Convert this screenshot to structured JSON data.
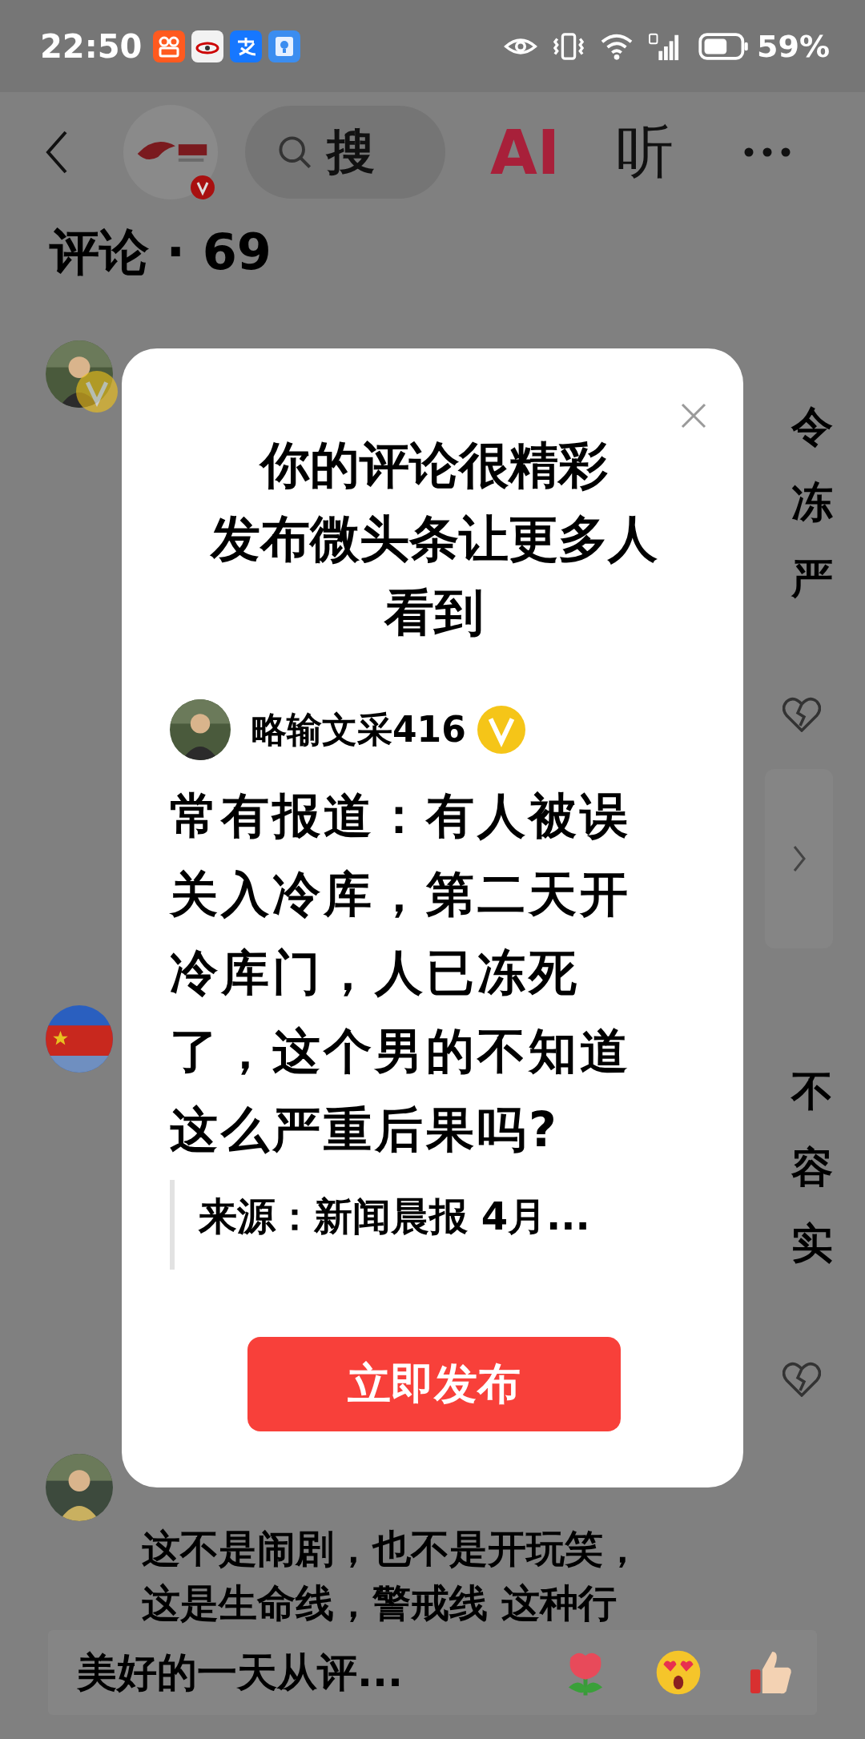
{
  "status_bar": {
    "time": "22:50",
    "battery": "59%"
  },
  "header": {
    "search_text": "搜",
    "ai_label": "AI",
    "listen_label": "听",
    "verified": true
  },
  "comments_heading": "评论 · 69",
  "comments": [
    {
      "verified": true,
      "fragments": [
        "令",
        "冻",
        "严"
      ],
      "has_card": true
    },
    {
      "verified": false,
      "fragments": [
        "不",
        "容",
        "实"
      ],
      "has_card": false
    },
    {
      "verified": false,
      "lines": [
        "这不是闹剧，也不是开玩笑，",
        "这是生命线，警戒线 这种行"
      ]
    }
  ],
  "comment_box": {
    "placeholder": "美好的一天从评..."
  },
  "dialog": {
    "title": [
      "你的评论很精彩",
      "发布微头条让更多人看到"
    ],
    "post": {
      "author": "略输文采416",
      "verified": true,
      "text": "常有报道：有人被误关入冷库，第二天开冷库门，人已冻死了，这个男的不知道这么严重后果吗?",
      "source": "来源：新闻晨报 4月..."
    },
    "button": "立即发布"
  }
}
